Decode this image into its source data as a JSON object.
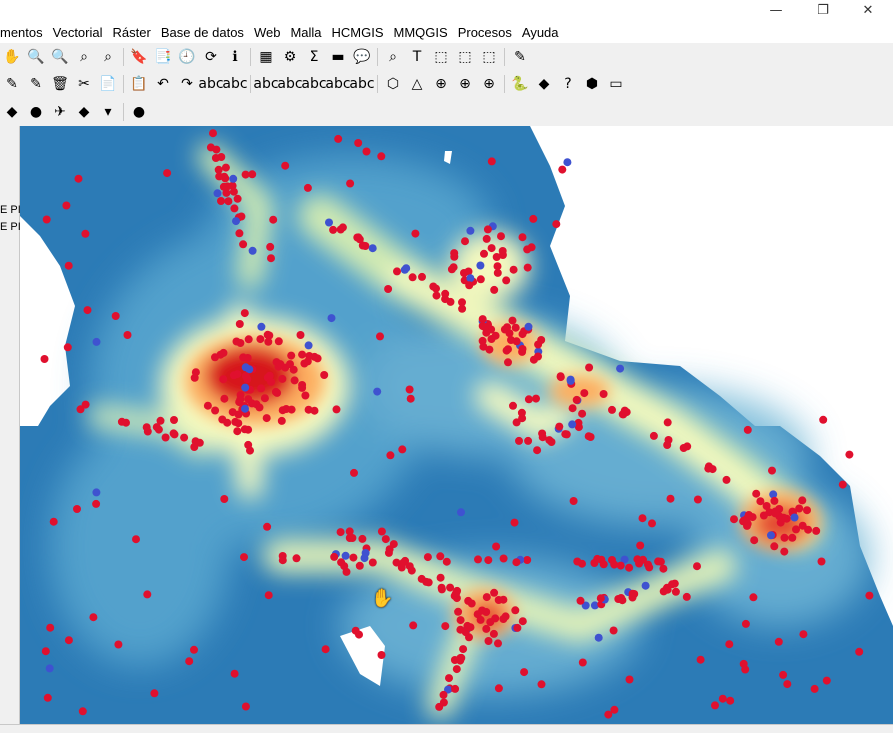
{
  "menu": {
    "items": [
      "mentos",
      "Vectorial",
      "Ráster",
      "Base de datos",
      "Web",
      "Malla",
      "HCMGIS",
      "MMQGIS",
      "Procesos",
      "Ayuda"
    ]
  },
  "window": {
    "minimize_icon": "—",
    "restore_icon": "❐",
    "close_icon": "✕"
  },
  "toolbars": {
    "row1": [
      "✋",
      "🔍",
      "🔍",
      "⌕",
      "⌕",
      "🔖",
      "📑",
      "🕘",
      "⟳",
      "ℹ",
      "▦",
      "⚙",
      "Σ",
      "▬",
      "💬",
      "⌕",
      "T",
      "⬚",
      "⬚",
      "⬚",
      "✎"
    ],
    "row2": [
      "✎",
      "✎",
      "🗑",
      "✂",
      "📄",
      "📋",
      "↶",
      "↷",
      "abc",
      "abc",
      "abc",
      "abc",
      "abc",
      "abc",
      "abc",
      "⬡",
      "△",
      "⊕",
      "⊕",
      "⊕",
      "🐍",
      "◆",
      "?",
      "⬢",
      "▭"
    ],
    "row3": [
      "◆",
      "●",
      "✈",
      "◆",
      "▾",
      "●"
    ]
  },
  "sidepanel": {
    "labels": [
      "E PI",
      "E PI"
    ]
  },
  "colors": {
    "accent": "#2b7bb9",
    "point_red": "#e0102e",
    "point_blue": "#3f52d0",
    "heat_low": "#2c7bb6",
    "heat_mid": "#ffffbf",
    "heat_high": "#d7191c"
  }
}
